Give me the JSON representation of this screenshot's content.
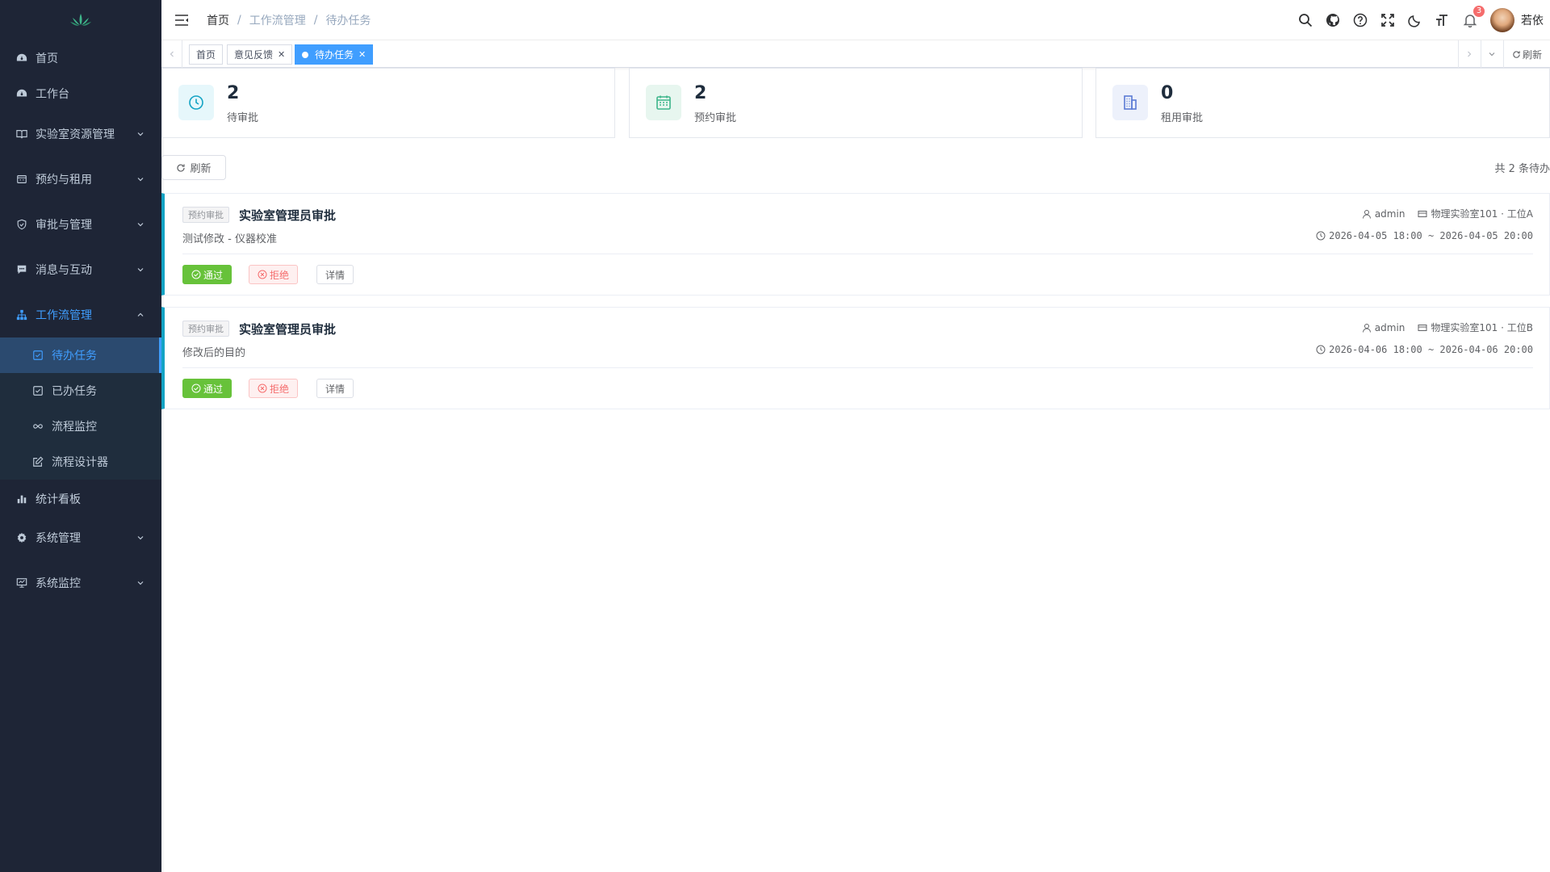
{
  "sidebar": {
    "items": [
      {
        "label": "首页",
        "icon": "dashboard-icon"
      },
      {
        "label": "工作台",
        "icon": "dashboard-icon"
      },
      {
        "label": "实验室资源管理",
        "icon": "book-icon"
      },
      {
        "label": "预约与租用",
        "icon": "calendar-icon"
      },
      {
        "label": "审批与管理",
        "icon": "shield-check-icon"
      },
      {
        "label": "消息与互动",
        "icon": "message-icon"
      },
      {
        "label": "工作流管理",
        "icon": "tree-icon"
      },
      {
        "label": "统计看板",
        "icon": "bar-chart-icon"
      },
      {
        "label": "系统管理",
        "icon": "gear-icon"
      },
      {
        "label": "系统监控",
        "icon": "monitor-icon"
      }
    ],
    "workflow_sub": [
      {
        "label": "待办任务"
      },
      {
        "label": "已办任务"
      },
      {
        "label": "流程监控"
      },
      {
        "label": "流程设计器"
      }
    ]
  },
  "breadcrumb": [
    "首页",
    "工作流管理",
    "待办任务"
  ],
  "header": {
    "username": "若依",
    "notification_count": "3"
  },
  "tags": [
    {
      "label": "首页"
    },
    {
      "label": "意见反馈"
    },
    {
      "label": "待办任务"
    }
  ],
  "tags_refresh": "刷新",
  "stats": [
    {
      "value": "2",
      "label": "待审批"
    },
    {
      "value": "2",
      "label": "预约审批"
    },
    {
      "value": "0",
      "label": "租用审批"
    }
  ],
  "toolbar": {
    "refresh_label": "刷新",
    "total_text": "共 2 条待办"
  },
  "tasks": [
    {
      "tag": "预约审批",
      "title": "实验室管理员审批",
      "desc": "测试修改 - 仪器校准",
      "user": "admin",
      "location": "物理实验室101 · 工位A",
      "time": "2026-04-05 18:00 ~ 2026-04-05 20:00"
    },
    {
      "tag": "预约审批",
      "title": "实验室管理员审批",
      "desc": "修改后的目的",
      "user": "admin",
      "location": "物理实验室101 · 工位B",
      "time": "2026-04-06 18:00 ~ 2026-04-06 20:00"
    }
  ],
  "actions": {
    "pass": "通过",
    "reject": "拒绝",
    "detail": "详情"
  },
  "colors": {
    "sidebar_bg": "#1e2536",
    "accent": "#409eff",
    "card_border_accent": "#13a3c4",
    "success": "#67c23a",
    "danger": "#f56c6c"
  }
}
